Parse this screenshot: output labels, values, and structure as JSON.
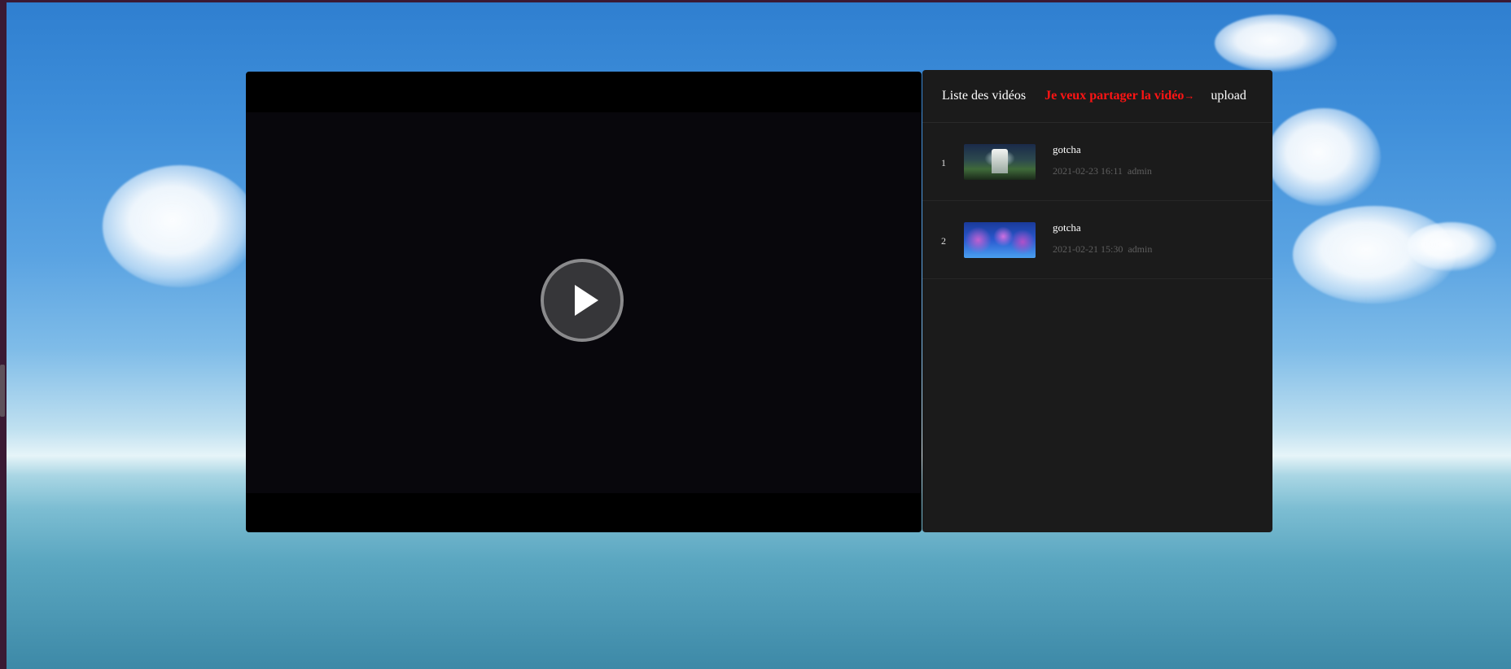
{
  "player": {
    "play_icon": "play-icon"
  },
  "playlist": {
    "tabs": {
      "list_label": "Liste des vidéos",
      "share_label": "Je veux partager la vidéo",
      "share_arrow": "→",
      "upload_label": "upload"
    },
    "items": [
      {
        "index": "1",
        "title": "gotcha",
        "date": "2021-02-23 16:11",
        "author": "admin"
      },
      {
        "index": "2",
        "title": "gotcha",
        "date": "2021-02-21 15:30",
        "author": "admin"
      }
    ]
  },
  "colors": {
    "share_accent": "#ff1414",
    "panel_background": "#1b1b1b",
    "meta_text": "#5f5f5f"
  }
}
